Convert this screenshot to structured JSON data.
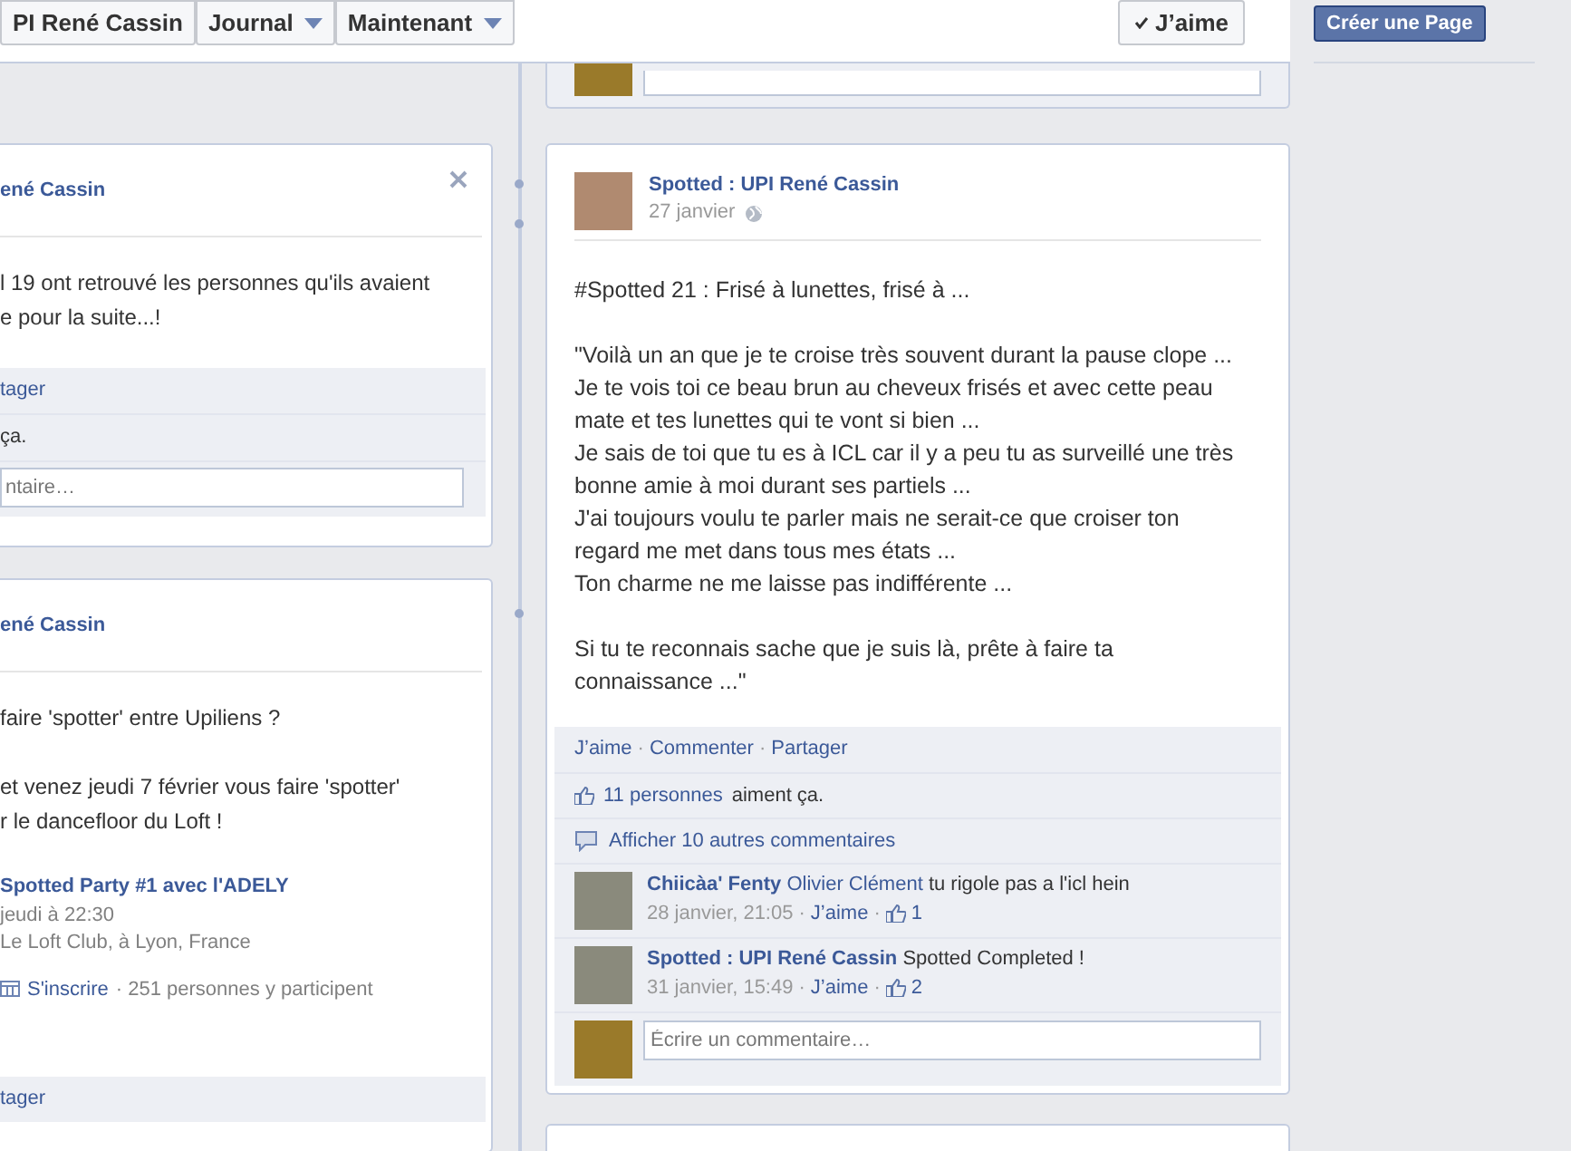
{
  "header": {
    "nav": [
      {
        "label": "PI René Cassin",
        "dropdown": false
      },
      {
        "label": "Journal",
        "dropdown": true
      },
      {
        "label": "Maintenant",
        "dropdown": true
      }
    ],
    "like_button": {
      "label": "J’aime",
      "checked": true
    }
  },
  "sidebar": {
    "create_page_button": "Créer une Page"
  },
  "left_posts": [
    {
      "author": "ené Cassin",
      "closable": true,
      "body": "l 19 ont retrouvé les personnes qu'ils avaient\ne pour la suite...!",
      "actions": "tager",
      "likes": "ça.",
      "comment_placeholder": "ntaire…"
    },
    {
      "author": "ené Cassin",
      "closable": false,
      "body": "faire 'spotter' entre Upiliens ?\n\net venez jeudi 7 février vous faire 'spotter'\nr le dancefloor du Loft !",
      "event": {
        "title": "Spotted Party #1 avec l'ADELY",
        "time": "jeudi à 22:30",
        "place": "Le Loft Club, à Lyon, France",
        "join": "S'inscrire",
        "attendees": "· 251 personnes y participent"
      },
      "actions": "tager"
    }
  ],
  "post": {
    "author": "Spotted : UPI René Cassin",
    "date": "27 janvier",
    "body": "#Spotted 21 : Frisé à lunettes, frisé à ...\n\n\"Voilà un an que je te croise très souvent durant la pause clope ...\nJe te vois toi ce beau brun au cheveux frisés et avec cette peau\nmate et tes lunettes qui te vont si bien ...\nJe sais de toi que tu es à ICL car il y a peu tu as surveillé une très\nbonne amie à moi durant ses partiels ...\nJ'ai toujours voulu te parler mais ne serait-ce que croiser ton\nregard me met dans tous mes états ...\nTon charme ne me laisse pas indifférente ...\n\nSi tu te reconnais sache que je suis là, prête à faire ta\nconnaissance ...\"",
    "actions": [
      {
        "kind": "link",
        "text": "J’aime"
      },
      {
        "kind": "separator",
        "text": "·"
      },
      {
        "kind": "link",
        "text": "Commenter"
      },
      {
        "kind": "separator",
        "text": "·"
      },
      {
        "kind": "link",
        "text": "Partager"
      }
    ],
    "likes": {
      "count": "11 personnes",
      "text": "aiment ça."
    },
    "more_comments": "Afficher 10 autres commentaires",
    "comments": [
      {
        "author": "Chiicàa' Fenty",
        "mention": "Olivier Clément",
        "text": "tu rigole pas a l'icl hein",
        "meta": [
          {
            "kind": "time",
            "text": "28 janvier, 21:05"
          },
          {
            "kind": "separator",
            "text": "·"
          },
          {
            "kind": "link",
            "text": "J’aime"
          },
          {
            "kind": "separator",
            "text": "·"
          },
          {
            "kind": "likes",
            "text": "1"
          }
        ]
      },
      {
        "author": "Spotted : UPI René Cassin",
        "text": "Spotted Completed !",
        "meta": [
          {
            "kind": "time",
            "text": "31 janvier, 15:49"
          },
          {
            "kind": "separator",
            "text": "·"
          },
          {
            "kind": "link",
            "text": "J’aime"
          },
          {
            "kind": "separator",
            "text": "·"
          },
          {
            "kind": "likes",
            "text": "2"
          }
        ]
      }
    ],
    "comment_placeholder": "Écrire un commentaire…"
  }
}
